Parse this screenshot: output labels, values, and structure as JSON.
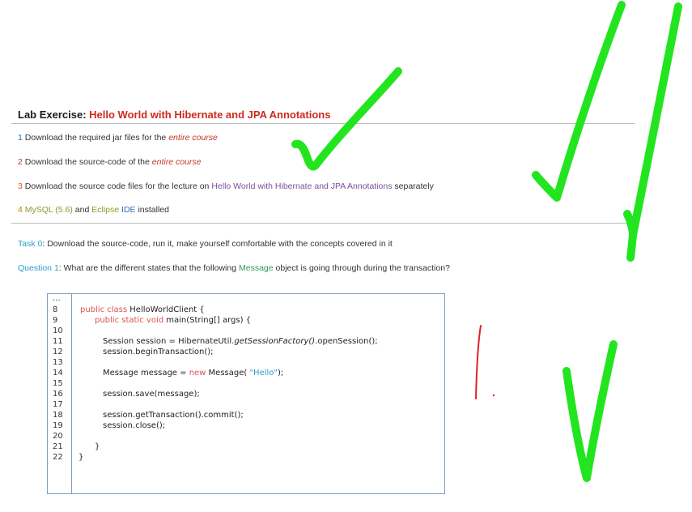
{
  "heading": {
    "prefix": "Lab Exercise: ",
    "title": "Hello World with Hibernate and JPA Annotations"
  },
  "items": [
    {
      "num": "1",
      "text_a": "Download the required jar files for the ",
      "emph": "entire course"
    },
    {
      "num": "2",
      "text_a": "Download the source-code of the ",
      "emph": "entire course"
    },
    {
      "num": "3",
      "text_a": "Download the source code files for the lecture on ",
      "link": "Hello World with Hibernate and JPA Annotations",
      "text_b": " separately"
    },
    {
      "num": "4",
      "mysql": "MySQL (5.6)",
      "and": " and ",
      "eclipse": "Eclipse",
      "ide": " IDE",
      "installed": " installed"
    }
  ],
  "task": {
    "label": "Task 0",
    "text": ": Download the source-code, run it, make yourself comfortable with the concepts covered in it"
  },
  "question": {
    "label": "Question 1",
    "text_a": ": What are the different states that the following ",
    "highlight": "Message",
    "text_b": " object is going through during the transaction?"
  },
  "code": {
    "line_numbers": [
      "...",
      "8",
      "9",
      "10",
      "11",
      "12",
      "13",
      "14",
      "15",
      "16",
      "17",
      "18",
      "19",
      "20",
      "21",
      "22"
    ],
    "l8_kw": "public class",
    "l8_rest": " HelloWorldClient {",
    "l9_kw": "public static void",
    "l9_rest": " main(String[] args) {",
    "l11_a": "Session session = HibernateUtil.",
    "l11_it": "getSessionFactory()",
    "l11_b": ".openSession();",
    "l12": "session.beginTransaction();",
    "l14_a": "Message message = ",
    "l14_kw": "new",
    "l14_b": " Message( ",
    "l14_str": "\"Hello\"",
    "l14_c": ");",
    "l16": "session.save(message);",
    "l18": "session.getTransaction().commit();",
    "l19": "session.close();",
    "l21": "}",
    "l22": "}"
  },
  "colors": {
    "annotation_green": "#22e51f",
    "annotation_red": "#e0202a",
    "title_red": "#cc2b1d",
    "border_blue": "#7e9cc0"
  }
}
